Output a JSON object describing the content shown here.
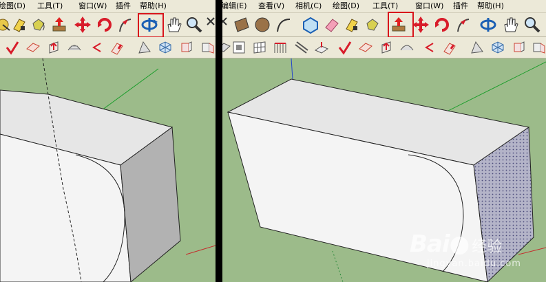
{
  "left": {
    "menu": [
      "绘图(D)",
      "工具(T)",
      "窗口(W)",
      "插件",
      "帮助(H)"
    ],
    "active_tool": "orbit-tool"
  },
  "right": {
    "menu": [
      "编辑(E)",
      "查看(V)",
      "相机(C)",
      "绘图(D)",
      "工具(T)",
      "窗口(W)",
      "插件",
      "帮助(H)"
    ],
    "active_tool": "push-pull-tool"
  },
  "colors": {
    "ground": "#9cbb8a",
    "face_light": "#f4f4f4",
    "face_top": "#e6e6e6",
    "face_shaded": "#b2b2b2",
    "highlight": "#d8141b"
  },
  "watermark": {
    "logo": "Bai",
    "logo_suffix": "经验",
    "url": "jingyan.baidu.com"
  }
}
